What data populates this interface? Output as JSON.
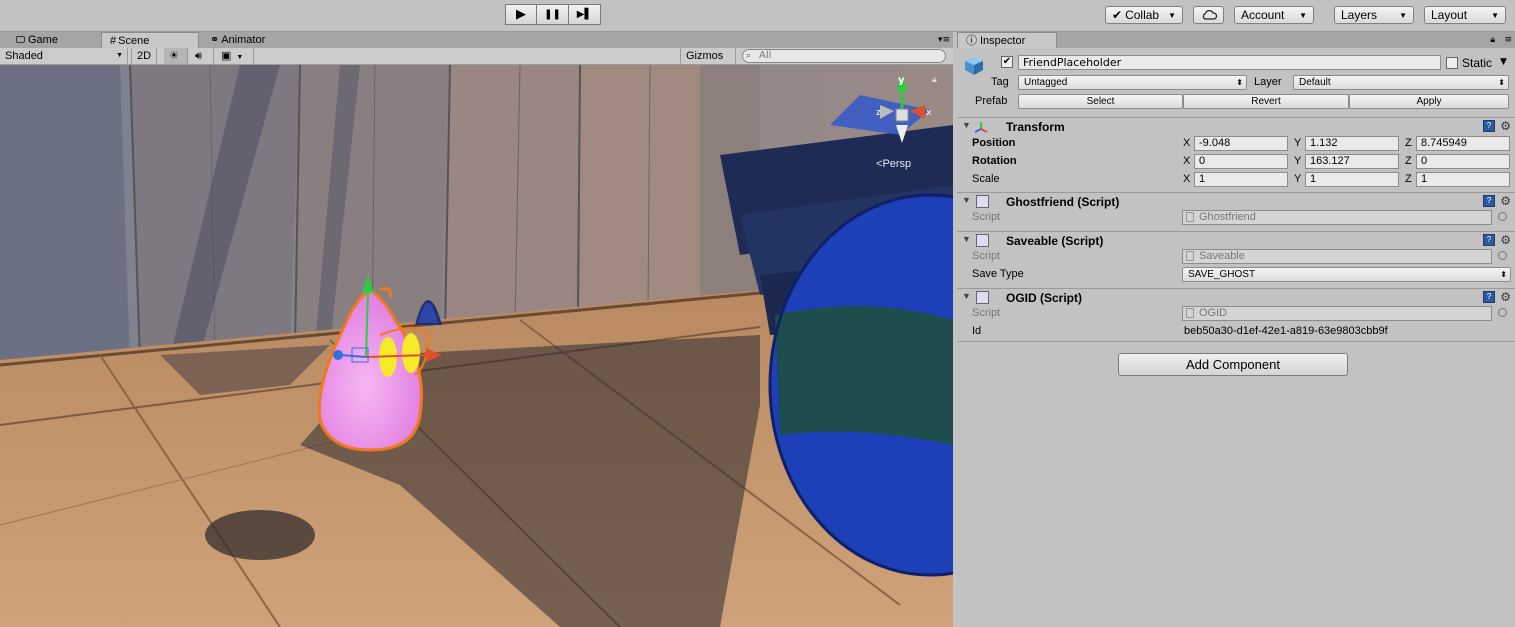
{
  "toolbar": {
    "play_icon": "▶",
    "pause_icon": "❚❚",
    "step_icon": "▶▌",
    "collab": "Collab",
    "account": "Account",
    "layers": "Layers",
    "layout": "Layout"
  },
  "scene": {
    "tabs": [
      {
        "label": "Game"
      },
      {
        "label": "Scene"
      },
      {
        "label": "Animator"
      }
    ],
    "shading_mode": "Shaded",
    "mode_2d": "2D",
    "gizmos": "Gizmos",
    "search_placeholder": "All",
    "persp_label": "Persp",
    "axis_labels": {
      "y": "y",
      "x": "x",
      "z": "z"
    }
  },
  "inspector": {
    "tab_label": "Inspector",
    "object_name": "FriendPlaceholder",
    "active": true,
    "static_label": "Static",
    "tag_label": "Tag",
    "tag_value": "Untagged",
    "layer_label": "Layer",
    "layer_value": "Default",
    "prefab_label": "Prefab",
    "prefab_select": "Select",
    "prefab_revert": "Revert",
    "prefab_apply": "Apply",
    "transform": {
      "title": "Transform",
      "position_label": "Position",
      "rotation_label": "Rotation",
      "scale_label": "Scale",
      "position": {
        "x": "-9.048",
        "y": "1.132",
        "z": "8.745949"
      },
      "rotation": {
        "x": "0",
        "y": "163.127",
        "z": "0"
      },
      "scale": {
        "x": "1",
        "y": "1",
        "z": "1"
      }
    },
    "ghostfriend": {
      "title": "Ghostfriend (Script)",
      "script_label": "Script",
      "script_value": "Ghostfriend"
    },
    "saveable": {
      "title": "Saveable (Script)",
      "script_label": "Script",
      "script_value": "Saveable",
      "savetype_label": "Save Type",
      "savetype_value": "SAVE_GHOST"
    },
    "ogid": {
      "title": "OGID (Script)",
      "script_label": "Script",
      "script_value": "OGID",
      "id_label": "Id",
      "id_value": "beb50a30-d1ef-42e1-a819-63e9803cbb9f"
    },
    "add_component": "Add Component"
  },
  "colors": {
    "ghost": "#e98be6",
    "selection_outline": "#f07a1a",
    "ball_blue": "#1d3fb8"
  }
}
